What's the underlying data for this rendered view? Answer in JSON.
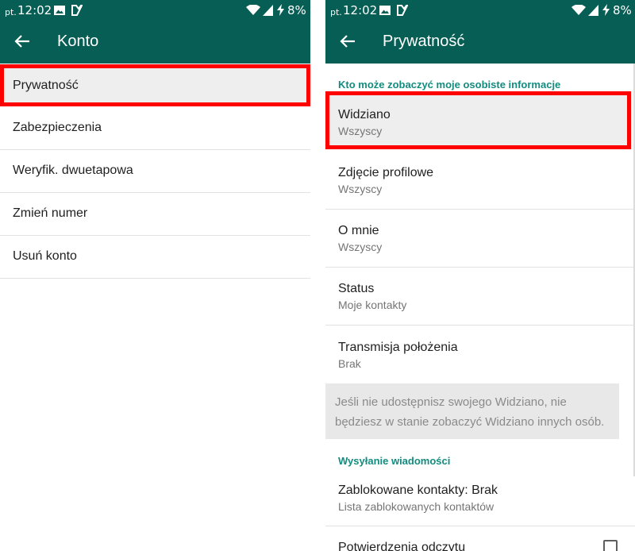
{
  "colors": {
    "toolbar": "#075e54",
    "accent": "#128c7e",
    "highlight_border": "#ff0000",
    "highlight_fill": "#eeeeee"
  },
  "status_bar": {
    "day": "pt.",
    "time": "12:02",
    "battery": "8%",
    "icons": [
      "image-icon",
      "app-notification-icon",
      "wifi-icon",
      "signal-icon",
      "charging-bolt-icon"
    ]
  },
  "left_screen": {
    "title": "Konto",
    "back_icon": "arrow-back-icon",
    "items": [
      {
        "label": "Prywatność",
        "highlighted": true
      },
      {
        "label": "Zabezpieczenia"
      },
      {
        "label": "Weryfik. dwuetapowa"
      },
      {
        "label": "Zmień numer"
      },
      {
        "label": "Usuń konto"
      }
    ]
  },
  "right_screen": {
    "title": "Prywatność",
    "back_icon": "arrow-back-icon",
    "section1_header": "Kto może zobaczyć moje osobiste informacje",
    "items": [
      {
        "label": "Widziano",
        "value": "Wszyscy",
        "highlighted": true
      },
      {
        "label": "Zdjęcie profilowe",
        "value": "Wszyscy"
      },
      {
        "label": "O mnie",
        "value": "Wszyscy"
      },
      {
        "label": "Status",
        "value": "Moje kontakty"
      },
      {
        "label": "Transmisja położenia",
        "value": "Brak"
      }
    ],
    "info_text_line1": "Jeśli nie udostępnisz swojego Widziano, nie",
    "info_text_line2": "będziesz w stanie zobaczyć Widziano innych osób.",
    "section2_header": "Wysyłanie wiadomości",
    "blocked": {
      "label": "Zablokowane kontakty: Brak",
      "value": "Lista zablokowanych kontaktów"
    },
    "read_receipts": {
      "label": "Potwierdzenia odczytu",
      "checked": false
    }
  }
}
